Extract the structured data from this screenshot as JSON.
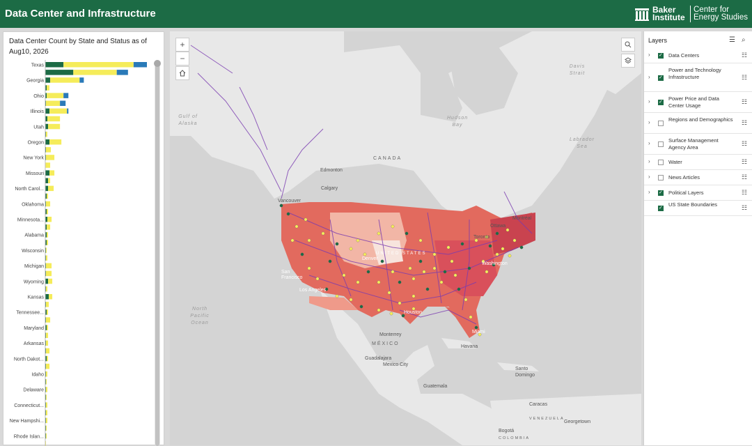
{
  "header": {
    "title": "Data Center and Infrastructure",
    "logo_primary": "Baker Institute",
    "logo_secondary": "Center for Energy Studies"
  },
  "colors": {
    "header": "#1c6b45",
    "operating": "#1c6b45",
    "planned": "#f5ec5a",
    "construction": "#2a7ab8"
  },
  "chart": {
    "title": "Data Center Count by State and Status as of Aug10, 2026"
  },
  "chart_data": {
    "type": "bar",
    "orientation": "horizontal",
    "stacked": true,
    "categories": [
      "Texas",
      "",
      "Georgia",
      "",
      "Ohio",
      "",
      "Illinois",
      "",
      "Utah",
      "",
      "Oregon",
      "",
      "New York",
      "",
      "Missouri",
      "",
      "North Carol...",
      "",
      "Oklahoma",
      "",
      "Minnesota...",
      "",
      "Alabama",
      "",
      "Wisconsin",
      "",
      "Michigan",
      "",
      "Wyoming",
      "",
      "Kansas",
      "",
      "Tennessee...",
      "",
      "Maryland",
      "",
      "Arkansas",
      "",
      "North Dakot...",
      "",
      "Idaho",
      "",
      "Delaware",
      "",
      "Connecticut...",
      "",
      "New Hampshi...",
      "",
      "Rhode Islan...",
      ""
    ],
    "series": [
      {
        "values": [
          26,
          40,
          7,
          2,
          2,
          1,
          6,
          3,
          4,
          1,
          6,
          1,
          1,
          0,
          6,
          4,
          4,
          2,
          1,
          2,
          3,
          2,
          2,
          2,
          1,
          1,
          1,
          1,
          4,
          1,
          5,
          1,
          2,
          1,
          2,
          1,
          1,
          1,
          2,
          1,
          1,
          1,
          1,
          1,
          1,
          1,
          1,
          1,
          1,
          0,
          1,
          1
        ]
      },
      {
        "values": [
          100,
          62,
          42,
          4,
          24,
          20,
          25,
          18,
          17,
          2,
          17,
          7,
          12,
          7,
          7,
          3,
          8,
          2,
          6,
          2,
          6,
          5,
          2,
          2,
          1,
          2,
          8,
          8,
          6,
          2,
          5,
          4,
          2,
          6,
          2,
          3,
          3,
          5,
          2,
          5,
          2,
          1,
          2,
          1,
          2,
          2,
          2,
          1,
          1,
          1,
          0,
          1
        ]
      },
      {
        "values": [
          19,
          16,
          6,
          0,
          7,
          8,
          2,
          0,
          0,
          0,
          0,
          0,
          0,
          0,
          0,
          0,
          0,
          0,
          0,
          0,
          0,
          0,
          0,
          0,
          0,
          0,
          0,
          0,
          0,
          0,
          0,
          0,
          0,
          0,
          0,
          0,
          0,
          0,
          0,
          0,
          0,
          0,
          0,
          0,
          0,
          0,
          0,
          0,
          0,
          0,
          0,
          0
        ]
      }
    ],
    "xlim": [
      0,
      160
    ]
  },
  "map": {
    "zoom_in": "+",
    "zoom_out": "−",
    "home_icon": "home-icon",
    "search_icon": "search-icon",
    "basemap_icon": "layers-icon",
    "labels": {
      "canada": "CANADA",
      "edmonton": "Edmonton",
      "calgary": "Calgary",
      "vancouver": "Vancouver",
      "ottawa": "Ottawa",
      "toronto": "Toronto",
      "montreal": "Montréal",
      "north_pacific": "North Pacific Ocean",
      "hudson_bay": "Hudson Bay",
      "labrador_sea": "Labrador Sea",
      "davis_strait": "Davis Strait",
      "gulf_alaska": "Gulf of Alaska",
      "monterrey": "Monterrey",
      "mexico": "MÉXICO",
      "guadalajara": "Guadalajara",
      "mexico_city": "Mexico City",
      "havana": "Havana",
      "santo_domingo": "Santo Domingo",
      "guatemala": "Guatemala",
      "caracas": "Caracas",
      "venezuela": "VENEZUELA",
      "georgetown": "Georgetown",
      "bogota": "Bogotá",
      "colombia": "COLOMBIA",
      "united_states": "UNITED STATES",
      "denver": "Denver",
      "los_angeles": "Los Angeles",
      "san_francisco": "San Francisco",
      "washington": "Washington",
      "houston": "Houston",
      "miami": "Miami"
    }
  },
  "layers": {
    "title": "Layers",
    "items": [
      {
        "label": "Data Centers",
        "checked": true,
        "expandable": true
      },
      {
        "label": "Power and Technology Infrastructure",
        "checked": true,
        "expandable": true
      },
      {
        "label": "Power Price and Data Center Usage",
        "checked": true,
        "expandable": true
      },
      {
        "label": "Regions and Demographics",
        "checked": false,
        "expandable": true
      },
      {
        "label": "Surface Management Agency Area",
        "checked": false,
        "expandable": true
      },
      {
        "label": "Water",
        "checked": false,
        "expandable": true
      },
      {
        "label": "News Articles",
        "checked": false,
        "expandable": true
      },
      {
        "label": "Political Layers",
        "checked": true,
        "expandable": true
      },
      {
        "label": "US State Boundaries",
        "checked": true,
        "expandable": false
      }
    ]
  }
}
